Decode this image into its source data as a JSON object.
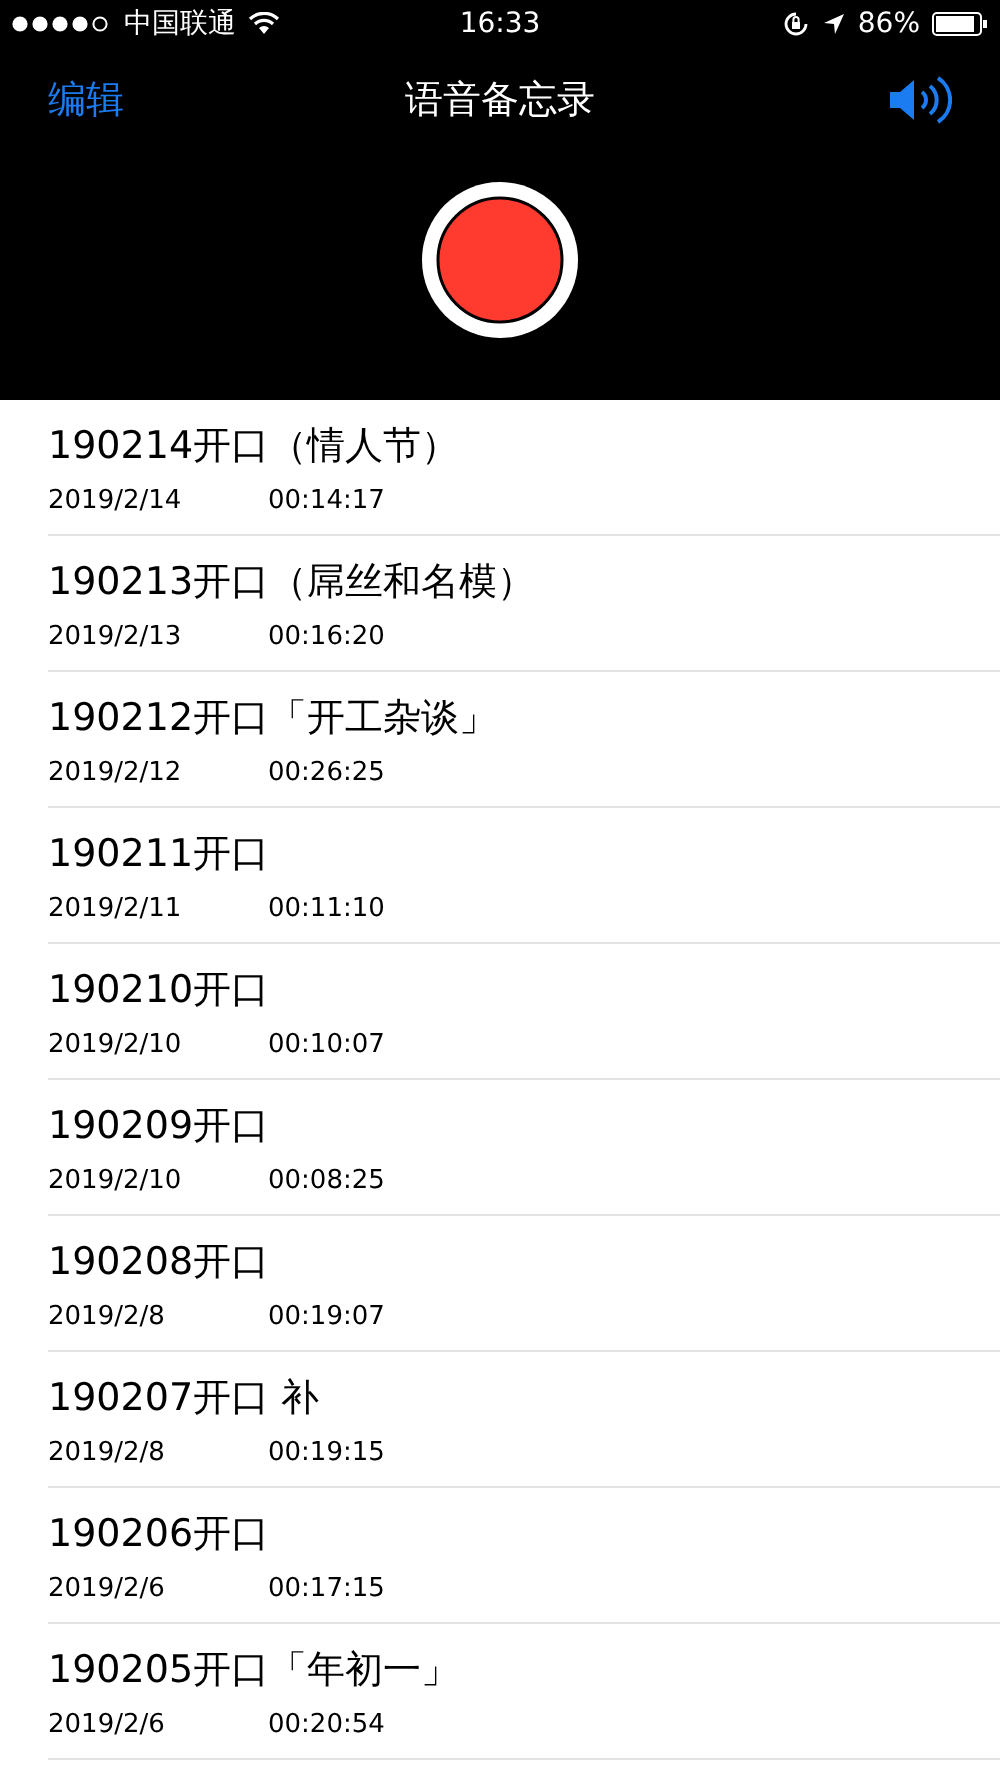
{
  "status_bar": {
    "carrier": "中国联通",
    "time": "16:33",
    "battery": "86%"
  },
  "nav": {
    "edit": "编辑",
    "title": "语音备忘录"
  },
  "recordings": [
    {
      "title": "190214开口（情人节）",
      "date": "2019/2/14",
      "duration": "00:14:17"
    },
    {
      "title": "190213开口（屌丝和名模）",
      "date": "2019/2/13",
      "duration": "00:16:20"
    },
    {
      "title": "190212开口「开工杂谈」",
      "date": "2019/2/12",
      "duration": "00:26:25"
    },
    {
      "title": "190211开口",
      "date": "2019/2/11",
      "duration": "00:11:10"
    },
    {
      "title": "190210开口",
      "date": "2019/2/10",
      "duration": "00:10:07"
    },
    {
      "title": "190209开口",
      "date": "2019/2/10",
      "duration": "00:08:25"
    },
    {
      "title": "190208开口",
      "date": "2019/2/8",
      "duration": "00:19:07"
    },
    {
      "title": "190207开口 补",
      "date": "2019/2/8",
      "duration": "00:19:15"
    },
    {
      "title": "190206开口",
      "date": "2019/2/6",
      "duration": "00:17:15"
    },
    {
      "title": "190205开口「年初一」",
      "date": "2019/2/6",
      "duration": "00:20:54"
    }
  ]
}
